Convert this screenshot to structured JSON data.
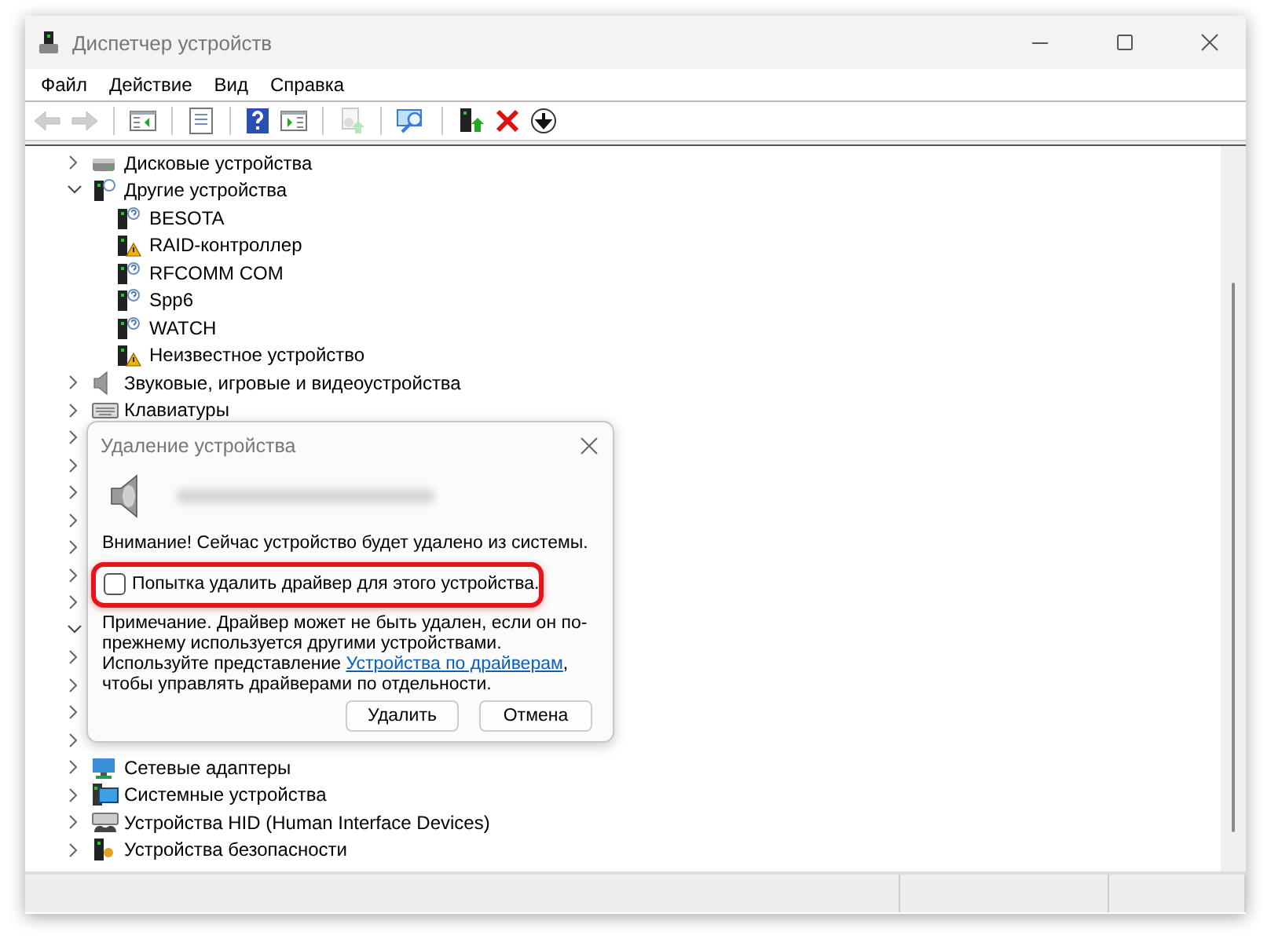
{
  "window": {
    "title": "Диспетчер устройств"
  },
  "menu": [
    "Файл",
    "Действие",
    "Вид",
    "Справка"
  ],
  "toolbar": [
    {
      "kind": "back",
      "disabled": true
    },
    {
      "kind": "forward",
      "disabled": true
    },
    {
      "kind": "sep"
    },
    {
      "kind": "tree_panel",
      "disabled": false
    },
    {
      "kind": "sep"
    },
    {
      "kind": "properties",
      "disabled": false
    },
    {
      "kind": "sep"
    },
    {
      "kind": "help",
      "disabled": false
    },
    {
      "kind": "action_panel",
      "disabled": false
    },
    {
      "kind": "sep"
    },
    {
      "kind": "update_driver",
      "disabled": true
    },
    {
      "kind": "sep"
    },
    {
      "kind": "scan",
      "disabled": false
    },
    {
      "kind": "sep"
    },
    {
      "kind": "enable",
      "disabled": false
    },
    {
      "kind": "remove",
      "disabled": false
    },
    {
      "kind": "disable",
      "disabled": false
    }
  ],
  "tree": [
    {
      "label": "Дисковые устройства",
      "kind": "disk",
      "expanded": false
    },
    {
      "label": "Другие устройства",
      "kind": "other",
      "expanded": true,
      "children": [
        {
          "label": "BESOTA",
          "kind": "unknown"
        },
        {
          "label": "RAID-контроллер",
          "kind": "warning"
        },
        {
          "label": "RFCOMM COM",
          "kind": "unknown"
        },
        {
          "label": "Spp6",
          "kind": "unknown"
        },
        {
          "label": "WATCH",
          "kind": "unknown"
        },
        {
          "label": "Неизвестное устройство",
          "kind": "warning"
        }
      ]
    },
    {
      "label": "Звуковые, игровые и видеоустройства",
      "kind": "sound",
      "expanded": false
    },
    {
      "label": "Клавиатуры",
      "kind": "keyboard",
      "expanded": false
    },
    {
      "expanded": false
    },
    {
      "expanded": false
    },
    {
      "expanded": false
    },
    {
      "expanded": false
    },
    {
      "expanded": false
    },
    {
      "expanded": false
    },
    {
      "expanded": false
    },
    {
      "expanded": true
    },
    {
      "expanded": false
    },
    {
      "expanded": false
    },
    {
      "expanded": false
    },
    {
      "expanded": false
    },
    {
      "label": "Сетевые адаптеры",
      "kind": "network",
      "expanded": false
    },
    {
      "label": "Системные устройства",
      "kind": "system",
      "expanded": false
    },
    {
      "label": "Устройства HID (Human Interface Devices)",
      "kind": "hid",
      "expanded": false
    },
    {
      "label": "Устройства безопасности",
      "kind": "security",
      "expanded": false
    }
  ],
  "dialog": {
    "title": "Удаление устройства",
    "warning": "Внимание! Сейчас устройство будет удалено из системы.",
    "checkbox": {
      "label": "Попытка удалить драйвер для этого устройства.",
      "checked": false
    },
    "note": "Примечание. Драйвер может не быть удален, если он по-прежнему используется другими устройствами.",
    "hint_before": "Используйте представление ",
    "link": "Устройства по драйверам",
    "hint_after": ", чтобы управлять драйверами по отдельности.",
    "buttons": [
      "Удалить",
      "Отмена"
    ]
  }
}
